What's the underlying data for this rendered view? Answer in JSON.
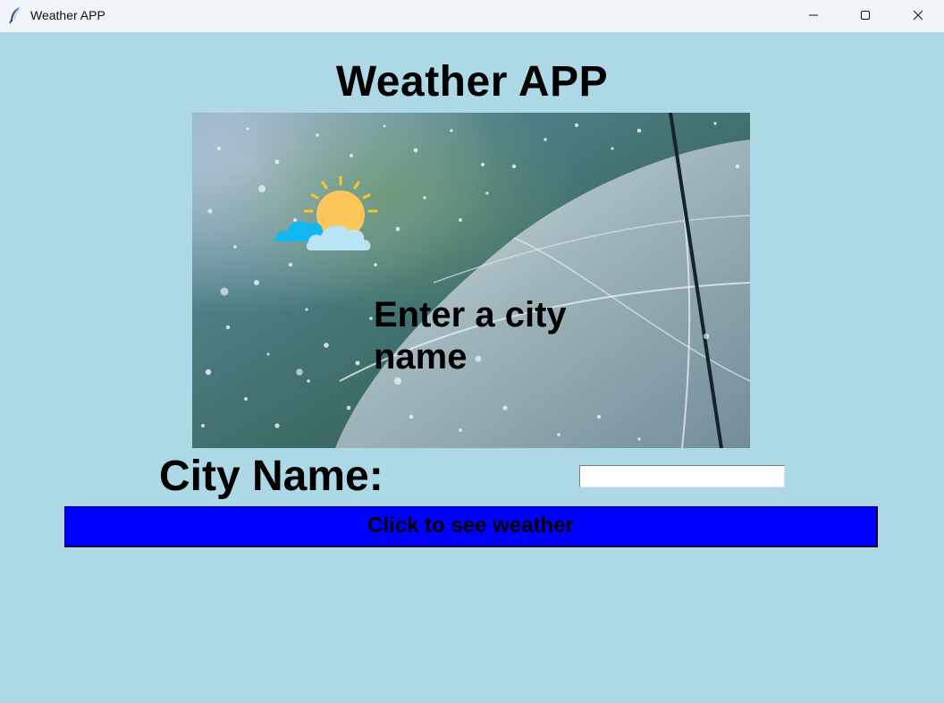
{
  "window": {
    "title": "Weather APP",
    "icon": "feather-icon",
    "controls": [
      "minimize-icon",
      "maximize-icon",
      "close-icon"
    ]
  },
  "app": {
    "heading": "Weather APP",
    "background_color": "#add8e6"
  },
  "hero": {
    "image": "rain-umbrella-photo",
    "weather_icon": "sun-behind-cloud-icon",
    "message": "Enter a city name"
  },
  "form": {
    "city_label": "City Name:",
    "city_value": "",
    "submit_label": "Click to see weather",
    "submit_color": "#0000ff"
  }
}
